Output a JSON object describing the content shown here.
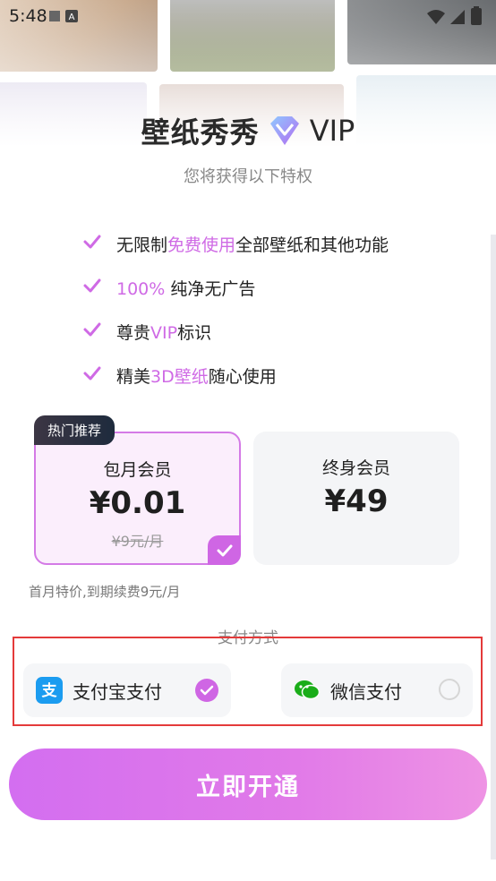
{
  "status_bar": {
    "time": "5:48"
  },
  "header": {
    "title": "壁纸秀秀",
    "vip_text": "VIP",
    "subtitle": "您将获得以下特权"
  },
  "benefits": [
    {
      "pre": "无限制",
      "hl": "免费使用",
      "post": "全部壁纸和其他功能"
    },
    {
      "pre": "",
      "hl": "100%",
      "post": " 纯净无广告"
    },
    {
      "pre": "尊贵",
      "hl": "VIP",
      "post": "标识"
    },
    {
      "pre": "精美",
      "hl": "3D壁纸",
      "post": "随心使用"
    }
  ],
  "plans": {
    "badge": "热门推荐",
    "monthly": {
      "name": "包月会员",
      "price": "¥0.01",
      "original": "¥9元/月"
    },
    "lifetime": {
      "name": "终身会员",
      "price": "¥49"
    }
  },
  "note": "首月特价,到期续费9元/月",
  "payment": {
    "label": "支付方式",
    "alipay": "支付宝支付",
    "wechat": "微信支付"
  },
  "cta": "立即开通",
  "colors": {
    "accent": "#cf66e4",
    "highlight_text": "#cf6ae5",
    "highlight_box": "#e43a3a",
    "alipay_blue": "#1b9cf0",
    "wechat_green": "#1aad19"
  }
}
